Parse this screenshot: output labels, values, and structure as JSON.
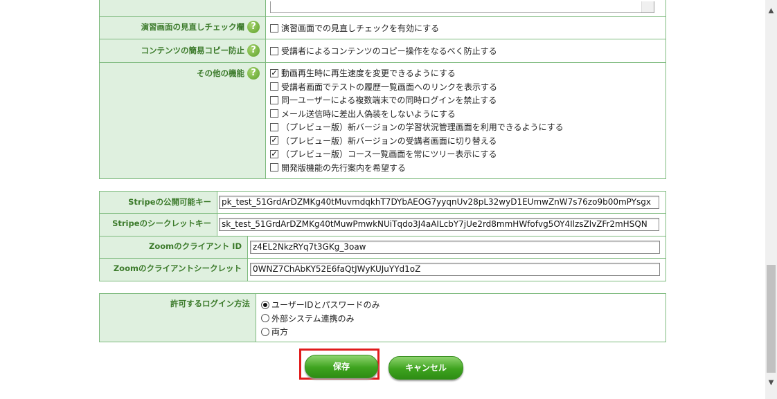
{
  "top_partial": {},
  "rows": {
    "review_check": {
      "label": "演習画面の見直しチェック欄",
      "help": "?",
      "option": "演習画面での見直しチェックを有効にする"
    },
    "copy_protect": {
      "label": "コンテンツの簡易コピー防止",
      "help": "?",
      "option": "受講者によるコンテンツのコピー操作をなるべく防止する"
    },
    "other": {
      "label": "その他の機能",
      "help": "?",
      "options": [
        {
          "text": "動画再生時に再生速度を変更できるようにする",
          "checked": true
        },
        {
          "text": "受講者画面でテストの履歴一覧画面へのリンクを表示する",
          "checked": false
        },
        {
          "text": "同一ユーザーによる複数端末での同時ログインを禁止する",
          "checked": false
        },
        {
          "text": "メール送信時に差出人偽装をしないようにする",
          "checked": false
        },
        {
          "text": "（プレビュー版）新バージョンの学習状況管理画面を利用できるようにする",
          "checked": false
        },
        {
          "text": "（プレビュー版）新バージョンの受講者画面に切り替える",
          "checked": true
        },
        {
          "text": "（プレビュー版）コース一覧画面を常にツリー表示にする",
          "checked": true
        },
        {
          "text": "開発版機能の先行案内を希望する",
          "checked": false
        }
      ]
    }
  },
  "stripe": {
    "public_label": "Stripeの公開可能キー",
    "public_value": "pk_test_51GrdArDZMKg40tMuvmdqkhT7DYbAEOG7yyqnUv28pL32wyD1EUmwZnW7s76zo9b00mPYsgx",
    "secret_label": "Stripeのシークレットキー",
    "secret_value": "sk_test_51GrdArDZMKg40tMuwPmwkNUiTqdo3J4aAILcbY7jUe2rd8mmHWfofvg5OY4IlzsZlvZFr2mHSQN"
  },
  "zoom": {
    "client_id_label": "Zoomのクライアント ID",
    "client_id_value": "z4EL2NkzRYq7t3GKg_3oaw",
    "client_secret_label": "Zoomのクライアントシークレット",
    "client_secret_value": "0WNZ7ChAbKY52E6faQtJWyKUJuYYd1oZ"
  },
  "login": {
    "label": "許可するログイン方法",
    "options": [
      {
        "text": "ユーザーIDとパスワードのみ",
        "selected": true
      },
      {
        "text": "外部システム連携のみ",
        "selected": false
      },
      {
        "text": "両方",
        "selected": false
      }
    ]
  },
  "buttons": {
    "save": "保存",
    "cancel": "キャンセル"
  },
  "colors": {
    "label_bg": "#dff0df",
    "label_text": "#3b7a2a",
    "border": "#7cb97c",
    "button": "#3ea31f",
    "highlight": "#e01b1b"
  }
}
